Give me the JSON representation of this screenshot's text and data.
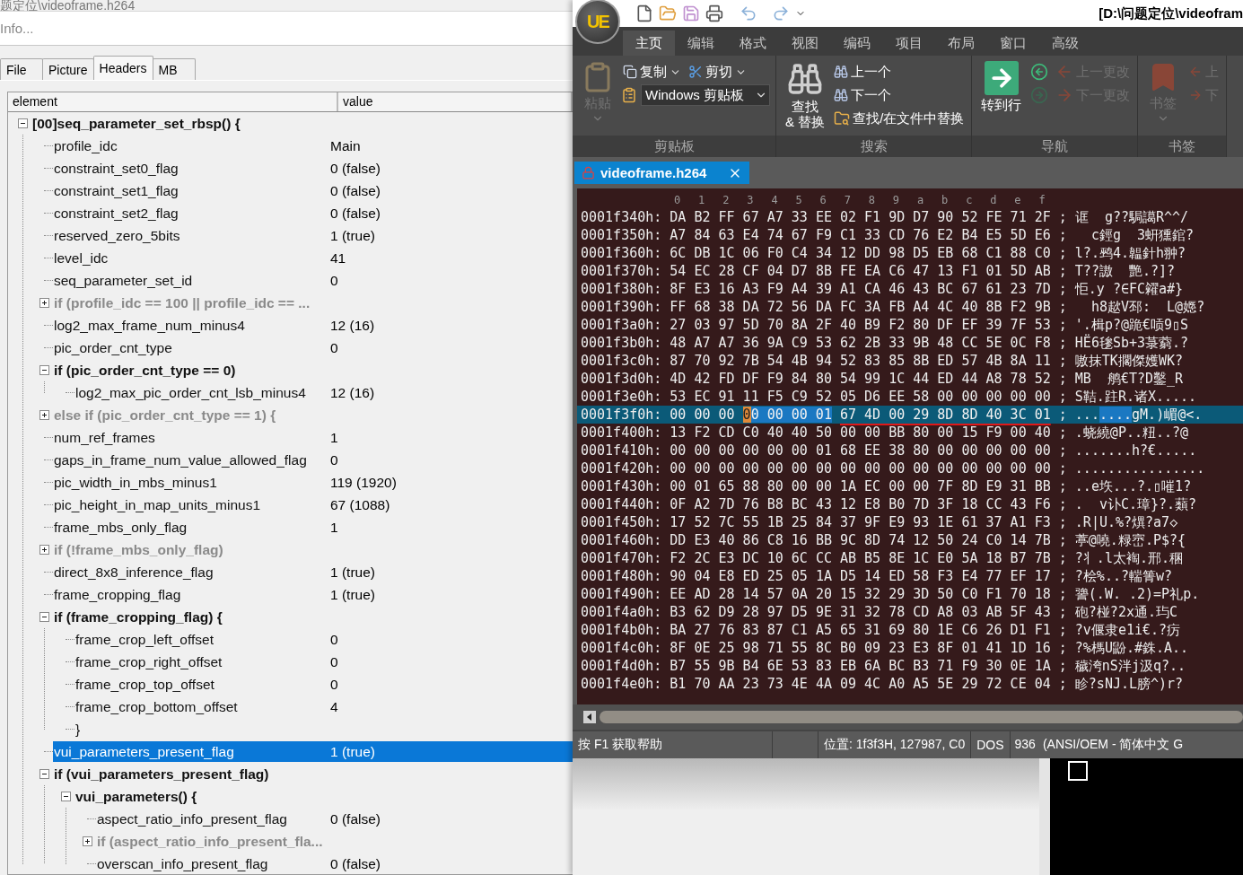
{
  "analyzer": {
    "title": "题定位\\videoframe.h264",
    "info": "Info...",
    "tabs": [
      {
        "label": "File",
        "selected": false
      },
      {
        "label": "Picture",
        "selected": false
      },
      {
        "label": "Headers",
        "selected": true
      },
      {
        "label": "MB",
        "selected": false
      }
    ],
    "tree": {
      "columns": [
        "element",
        "value"
      ],
      "nodes": [
        {
          "label": "[00]seq_parameter_set_rbsp() {",
          "expanded": true,
          "selected": false,
          "children": [
            {
              "label": "profile_idc",
              "value": "Main",
              "selected": false
            },
            {
              "label": "constraint_set0_flag",
              "value": "0 (false)",
              "selected": false
            },
            {
              "label": "constraint_set1_flag",
              "value": "0 (false)",
              "selected": false
            },
            {
              "label": "constraint_set2_flag",
              "value": "0 (false)",
              "selected": false
            },
            {
              "label": "reserved_zero_5bits",
              "value": "1 (true)",
              "selected": false
            },
            {
              "label": "level_idc",
              "value": "41",
              "selected": false
            },
            {
              "label": "seq_parameter_set_id",
              "value": "0",
              "selected": false
            },
            {
              "label": "if (profile_idc == 100 || profile_idc == ...",
              "expanded": false,
              "selected": false
            },
            {
              "label": "log2_max_frame_num_minus4",
              "value": "12 (16)",
              "selected": false
            },
            {
              "label": "pic_order_cnt_type",
              "value": "0",
              "selected": false
            },
            {
              "label": "if (pic_order_cnt_type == 0)",
              "expanded": true,
              "selected": false,
              "children": [
                {
                  "label": "log2_max_pic_order_cnt_lsb_minus4",
                  "value": "12 (16)",
                  "selected": false
                }
              ]
            },
            {
              "label": "else if (pic_order_cnt_type == 1) {",
              "expanded": false,
              "selected": false
            },
            {
              "label": "num_ref_frames",
              "value": "1",
              "selected": false
            },
            {
              "label": "gaps_in_frame_num_value_allowed_flag",
              "value": "0",
              "selected": false
            },
            {
              "label": "pic_width_in_mbs_minus1",
              "value": "119 (1920)",
              "selected": false
            },
            {
              "label": "pic_height_in_map_units_minus1",
              "value": "67 (1088)",
              "selected": false
            },
            {
              "label": "frame_mbs_only_flag",
              "value": "1",
              "selected": false
            },
            {
              "label": "if (!frame_mbs_only_flag)",
              "expanded": false,
              "selected": false
            },
            {
              "label": "direct_8x8_inference_flag",
              "value": "1 (true)",
              "selected": false
            },
            {
              "label": "frame_cropping_flag",
              "value": "1 (true)",
              "selected": false
            },
            {
              "label": "if (frame_cropping_flag) {",
              "expanded": true,
              "selected": false,
              "children": [
                {
                  "label": "frame_crop_left_offset",
                  "value": "0",
                  "selected": false
                },
                {
                  "label": "frame_crop_right_offset",
                  "value": "0",
                  "selected": false
                },
                {
                  "label": "frame_crop_top_offset",
                  "value": "0",
                  "selected": false
                },
                {
                  "label": "frame_crop_bottom_offset",
                  "value": "4",
                  "selected": false
                },
                {
                  "label": "}",
                  "selected": false
                }
              ]
            },
            {
              "label": "vui_parameters_present_flag",
              "value": "1 (true)",
              "selected": true
            },
            {
              "label": "if (vui_parameters_present_flag)",
              "expanded": true,
              "selected": false,
              "children": [
                {
                  "label": "vui_parameters() {",
                  "expanded": true,
                  "selected": false,
                  "children": [
                    {
                      "label": "aspect_ratio_info_present_flag",
                      "value": "0 (false)",
                      "selected": false
                    },
                    {
                      "label": "if (aspect_ratio_info_present_fla...",
                      "expanded": false,
                      "selected": false
                    },
                    {
                      "label": "overscan_info_present_flag",
                      "value": "0 (false)",
                      "selected": false
                    }
                  ]
                }
              ]
            }
          ]
        }
      ]
    }
  },
  "editor": {
    "logo": "UE",
    "title": "[D:\\问题定位\\videofram",
    "ribbon_tabs": [
      {
        "label": "主页",
        "selected": true
      },
      {
        "label": "编辑",
        "selected": false
      },
      {
        "label": "格式",
        "selected": false
      },
      {
        "label": "视图",
        "selected": false
      },
      {
        "label": "编码",
        "selected": false
      },
      {
        "label": "项目",
        "selected": false
      },
      {
        "label": "布局",
        "selected": false
      },
      {
        "label": "窗口",
        "selected": false
      },
      {
        "label": "高级",
        "selected": false
      }
    ],
    "groups": [
      {
        "label": "剪贴板",
        "large": [
          {
            "label": "粘贴",
            "kind": "split",
            "disabled": true
          }
        ],
        "rows": [
          [
            {
              "label": "复制",
              "kind": "split",
              "disabled": false
            },
            {
              "label": "剪切",
              "kind": "split",
              "disabled": false
            }
          ],
          [
            {
              "label": "Windows 剪贴板",
              "kind": "dropdown",
              "disabled": false
            }
          ]
        ]
      },
      {
        "label": "搜索",
        "large": [
          {
            "label": "查找\n& 替换",
            "kind": "button",
            "disabled": false
          }
        ],
        "rows": [
          [
            {
              "label": "上一个",
              "kind": "button",
              "disabled": false
            }
          ],
          [
            {
              "label": "下一个",
              "kind": "button",
              "disabled": false
            }
          ],
          [
            {
              "label": "查找/在文件中替换",
              "kind": "button",
              "disabled": false
            }
          ]
        ]
      },
      {
        "label": "导航",
        "large": [
          {
            "label": "转到行",
            "kind": "button",
            "disabled": false
          }
        ],
        "rows": [
          [
            {
              "kind": "icon",
              "disabled": false
            },
            {
              "label": "上一更改",
              "kind": "button",
              "disabled": true
            }
          ],
          [
            {
              "kind": "icon",
              "disabled": true
            },
            {
              "label": "下一更改",
              "kind": "button",
              "disabled": true
            }
          ]
        ]
      },
      {
        "label": "书签",
        "large": [
          {
            "label": "书签",
            "kind": "split",
            "disabled": true
          }
        ],
        "rows": [
          [
            {
              "label": "上",
              "kind": "button",
              "disabled": true
            }
          ],
          [
            {
              "label": "下",
              "kind": "button",
              "disabled": true
            }
          ]
        ]
      }
    ],
    "file_tab": {
      "label": "videoframe.h264",
      "selected": true
    },
    "ruler": [
      "0",
      "1",
      "2",
      "3",
      "4",
      "5",
      "6",
      "7",
      "8",
      "9",
      "a",
      "b",
      "c",
      "d",
      "e",
      "f"
    ],
    "separator": ";",
    "rows": [
      {
        "address": "0001f340h:",
        "bytes": "DA B2 FF 67 A7 33 EE 02 F1 9D D7 90 52 FE 71 2F",
        "ascii": "诓  g??駶譪R^^/",
        "current": false
      },
      {
        "address": "0001f350h:",
        "bytes": "A7 84 63 E4 74 67 F9 C1 33 CD 76 E2 B4 E5 5D E6",
        "ascii": "  c鋞g  3蚈獯錧?",
        "current": false
      },
      {
        "address": "0001f360h:",
        "bytes": "6C DB 1C 06 F0 C4 34 12 DD 98 D5 EB 68 C1 88 C0",
        "ascii": "l?.鹀4.韞針h翀?",
        "current": false
      },
      {
        "address": "0001f370h:",
        "bytes": "54 EC 28 CF 04 D7 8B FE EA C6 47 13 F1 01 5D AB",
        "ascii": "T??謸  艷.?]?",
        "current": false
      },
      {
        "address": "0001f380h:",
        "bytes": "8F E3 16 A3 F9 A4 39 A1 CA 46 43 BC 67 61 23 7D",
        "ascii": "怇.y ?∈FC糴a#}",
        "current": false
      },
      {
        "address": "0001f390h:",
        "bytes": "FF 68 38 DA 72 56 DA FC 3A FB A4 4C 40 8B F2 9B",
        "ascii": "  h8趑V邳:  L@嫕?",
        "current": false
      },
      {
        "address": "0001f3a0h:",
        "bytes": "27 03 97 5D 70 8A 2F 40 B9 F2 80 DF EF 39 7F 53",
        "ascii": "'.楫p?@跪€唝9▯S",
        "current": false
      },
      {
        "address": "0001f3b0h:",
        "bytes": "48 A7 A7 36 9A C9 53 62 2B 33 9B 48 CC 5E 0C F8",
        "ascii": "HË6毶Sb+3菉藭.?",
        "current": false
      },
      {
        "address": "0001f3c0h:",
        "bytes": "87 70 92 7B 54 4B 94 52 83 85 8B ED 57 4B 8A 11",
        "ascii": "嗷抹TK擱傑嬳WK?",
        "current": false
      },
      {
        "address": "0001f3d0h:",
        "bytes": "4D 42 FD DF F9 84 80 54 99 1C 44 ED 44 A8 78 52",
        "ascii": "MB  鸼€T?D鑿_R",
        "current": false
      },
      {
        "address": "0001f3e0h:",
        "bytes": "53 EC 91 11 F5 C9 52 05 D6 EE 58 00 00 00 00 00",
        "ascii": "S鞊.跓R.诸X.....",
        "current": false
      },
      {
        "address": "0001f3f0h:",
        "current": true,
        "segments": [
          {
            "text": "00 00 00",
            "kind": "plain"
          },
          {
            "text": "0",
            "kind": "cursor"
          },
          {
            "text": "0 00 00 01",
            "kind": "selected"
          },
          {
            "text": "67 4D 00 29 8D 8D 40 3C 01",
            "kind": "underlined"
          }
        ],
        "ascii_segments": [
          {
            "text": "...",
            "kind": "plain"
          },
          {
            "text": "....",
            "kind": "selected"
          },
          {
            "text": "gM.)嵋@<.",
            "kind": "plain"
          }
        ]
      },
      {
        "address": "0001f400h:",
        "bytes": "13 F2 CD C0 40 40 50 00 00 BB 80 00 15 F9 00 40",
        "ascii": ".蛲繞@P..粈..?@",
        "current": false
      },
      {
        "address": "0001f410h:",
        "bytes": "00 00 00 00 00 00 01 68 EE 38 80 00 00 00 00 00",
        "ascii": ".......h?€.....",
        "current": false
      },
      {
        "address": "0001f420h:",
        "bytes": "00 00 00 00 00 00 00 00 00 00 00 00 00 00 00 00",
        "ascii": "................",
        "current": false
      },
      {
        "address": "0001f430h:",
        "bytes": "00 01 65 88 80 00 00 1A EC 00 00 7F 8D E9 31 BB",
        "ascii": "..e垁...?.▯嗺1?",
        "current": false
      },
      {
        "address": "0001f440h:",
        "bytes": "0F A2 7D 76 B8 BC 43 12 E8 B0 7D 3F 18 CC 43 F6",
        "ascii": ".  v讣C.璋}?.蘱?",
        "current": false
      },
      {
        "address": "0001f450h:",
        "bytes": "17 52 7C 55 1B 25 84 37 9F E9 93 1E 61 37 A1 F3",
        "ascii": ".R|U.%?熼?a7◇",
        "current": false
      },
      {
        "address": "0001f460h:",
        "bytes": "DD E3 40 86 C8 16 BB 9C 8D 74 12 50 24 C0 14 7B",
        "ascii": "葶@嘵.粶崈.P$?{",
        "current": false
      },
      {
        "address": "0001f470h:",
        "bytes": "F2 2C E3 DC 10 6C CC AB B5 8E 1C E0 5A 18 B7 7B",
        "ascii": "?丬.l太裪.邢.稛",
        "current": false
      },
      {
        "address": "0001f480h:",
        "bytes": "90 04 E8 ED 25 05 1A D5 14 ED 58 F3 E4 77 EF 17",
        "ascii": "?桧%..?輲箐w?",
        "current": false
      },
      {
        "address": "0001f490h:",
        "bytes": "EE AD 28 14 57 0A 20 15 32 29 3D 50 C0 F1 70 18",
        "ascii": "謽(.W. .2)=P礼p.",
        "current": false
      },
      {
        "address": "0001f4a0h:",
        "bytes": "B3 62 D9 28 97 D5 9E 31 32 78 CD A8 03 AB 5F 43",
        "ascii": "砲?椪?2x通.玙C",
        "current": false
      },
      {
        "address": "0001f4b0h:",
        "bytes": "BA 27 76 83 87 C1 A5 65 31 69 80 1E C6 26 D1 F1",
        "ascii": "?v偃隶e1i€.?疠",
        "current": false
      },
      {
        "address": "0001f4c0h:",
        "bytes": "8F 0E 25 98 71 55 8C B0 09 23 E3 8F 01 41 1D 16",
        "ascii": "?%榪U鼢.#銖.A..",
        "current": false
      },
      {
        "address": "0001f4d0h:",
        "bytes": "B7 55 9B B4 6E 53 83 EB 6A BC B3 71 F9 30 0E 1A",
        "ascii": "穢洿nS泮j汲q?..",
        "current": false
      },
      {
        "address": "0001f4e0h:",
        "bytes": "B1 70 AA 23 73 4E 4A 09 4C A0 A5 5E 29 72 CE 04",
        "ascii": "眕?sNJ.L膀^)r?",
        "current": false
      }
    ],
    "status_bar": {
      "help": "按 F1 获取帮助",
      "position": "位置: 1f3f3H, 127987, C0",
      "line_ending": "DOS",
      "codepage": "936",
      "encoding": "(ANSI/OEM - 简体中文 G"
    }
  }
}
